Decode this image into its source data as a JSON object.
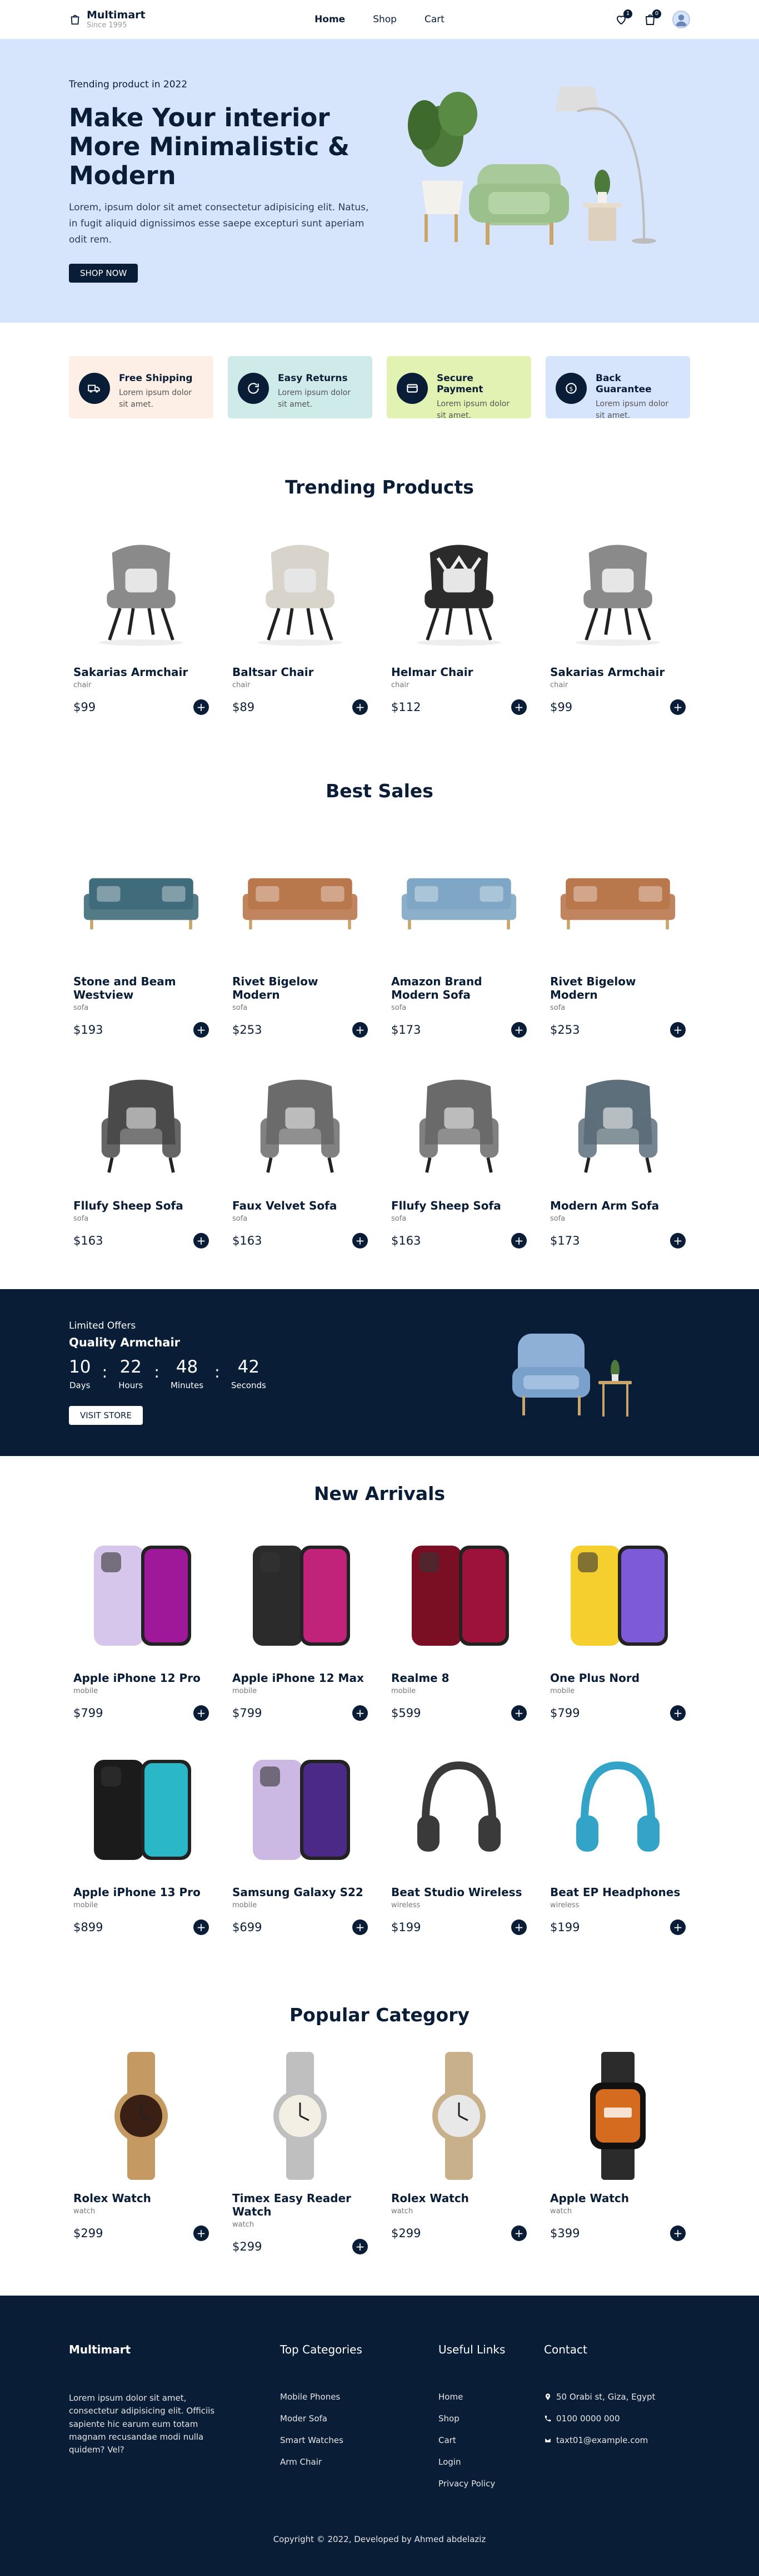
{
  "header": {
    "logo_title": "Multimart",
    "logo_sub": "Since 1995",
    "nav": [
      "Home",
      "Shop",
      "Cart"
    ],
    "fav_count": "1",
    "cart_count": "0"
  },
  "hero": {
    "subtitle": "Trending product in 2022",
    "title": "Make Your interior More Minimalistic & Modern",
    "desc": "Lorem, ipsum dolor sit amet consectetur adipisicing elit. Natus, in fugit aliquid dignissimos esse saepe excepturi sunt aperiam odit rem.",
    "button": "SHOP NOW"
  },
  "services": [
    {
      "title": "Free Shipping",
      "desc": "Lorem ipsum dolor sit amet.",
      "icon": "truck-icon",
      "bg": "#fdefe6"
    },
    {
      "title": "Easy Returns",
      "desc": "Lorem ipsum dolor sit amet.",
      "icon": "refresh-icon",
      "bg": "#ceebe9"
    },
    {
      "title": "Secure Payment",
      "desc": "Lorem ipsum dolor sit amet.",
      "icon": "secure-payment-icon",
      "bg": "#e2f2b2"
    },
    {
      "title": "Back Guarantee",
      "desc": "Lorem ipsum dolor sit amet.",
      "icon": "guarantee-icon",
      "bg": "#d6e5fb"
    }
  ],
  "trending": {
    "title": "Trending Products",
    "items": [
      {
        "name": "Sakarias Armchair",
        "cat": "chair",
        "price": "$99"
      },
      {
        "name": "Baltsar Chair",
        "cat": "chair",
        "price": "$89"
      },
      {
        "name": "Helmar Chair",
        "cat": "chair",
        "price": "$112"
      },
      {
        "name": "Sakarias Armchair",
        "cat": "chair",
        "price": "$99"
      }
    ]
  },
  "best_sales": {
    "title": "Best Sales",
    "items": [
      {
        "name": "Stone and Beam Westview",
        "cat": "sofa",
        "price": "$193"
      },
      {
        "name": "Rivet Bigelow Modern",
        "cat": "sofa",
        "price": "$253"
      },
      {
        "name": "Amazon Brand Modern Sofa",
        "cat": "sofa",
        "price": "$173"
      },
      {
        "name": "Rivet Bigelow Modern",
        "cat": "sofa",
        "price": "$253"
      },
      {
        "name": "Fllufy Sheep Sofa",
        "cat": "sofa",
        "price": "$163"
      },
      {
        "name": "Faux Velvet Sofa",
        "cat": "sofa",
        "price": "$163"
      },
      {
        "name": "Fllufy Sheep Sofa",
        "cat": "sofa",
        "price": "$163"
      },
      {
        "name": "Modern Arm Sofa",
        "cat": "sofa",
        "price": "$173"
      }
    ]
  },
  "timer": {
    "subtitle": "Limited Offers",
    "title": "Quality Armchair",
    "days": "10",
    "hours": "22",
    "minutes": "48",
    "seconds": "42",
    "days_label": "Days",
    "hours_label": "Hours",
    "minutes_label": "Minutes",
    "seconds_label": "Seconds",
    "button": "VISIT STORE"
  },
  "new_arrivals": {
    "title": "New Arrivals",
    "items": [
      {
        "name": "Apple iPhone 12 Pro",
        "cat": "mobile",
        "price": "$799"
      },
      {
        "name": "Apple iPhone 12 Max",
        "cat": "mobile",
        "price": "$799"
      },
      {
        "name": "Realme 8",
        "cat": "mobile",
        "price": "$599"
      },
      {
        "name": "One Plus Nord",
        "cat": "mobile",
        "price": "$799"
      },
      {
        "name": "Apple iPhone 13 Pro",
        "cat": "mobile",
        "price": "$899"
      },
      {
        "name": "Samsung Galaxy S22",
        "cat": "mobile",
        "price": "$699"
      },
      {
        "name": "Beat Studio Wireless",
        "cat": "wireless",
        "price": "$199"
      },
      {
        "name": "Beat EP Headphones",
        "cat": "wireless",
        "price": "$199"
      }
    ]
  },
  "popular": {
    "title": "Popular Category",
    "items": [
      {
        "name": "Rolex Watch",
        "cat": "watch",
        "price": "$299"
      },
      {
        "name": "Timex Easy Reader Watch",
        "cat": "watch",
        "price": "$299"
      },
      {
        "name": "Rolex Watch",
        "cat": "watch",
        "price": "$299"
      },
      {
        "name": "Apple Watch",
        "cat": "watch",
        "price": "$399"
      }
    ]
  },
  "footer": {
    "brand": "Multimart",
    "about": "Lorem ipsum dolor sit amet, consectetur adipisicing elit. Officiis sapiente hic earum eum totam magnam recusandae modi nulla quidem? Vel?",
    "categories_title": "Top Categories",
    "categories": [
      "Mobile Phones",
      "Moder Sofa",
      "Smart Watches",
      "Arm Chair"
    ],
    "links_title": "Useful Links",
    "links": [
      "Home",
      "Shop",
      "Cart",
      "Login",
      "Privacy Policy"
    ],
    "contact_title": "Contact",
    "address": "50 Orabi st, Giza, Egypt",
    "phone": "0100 0000 000",
    "email": "taxt01@example.com",
    "copyright": "Copyright © 2022, Developed by Ahmed abdelaziz"
  }
}
